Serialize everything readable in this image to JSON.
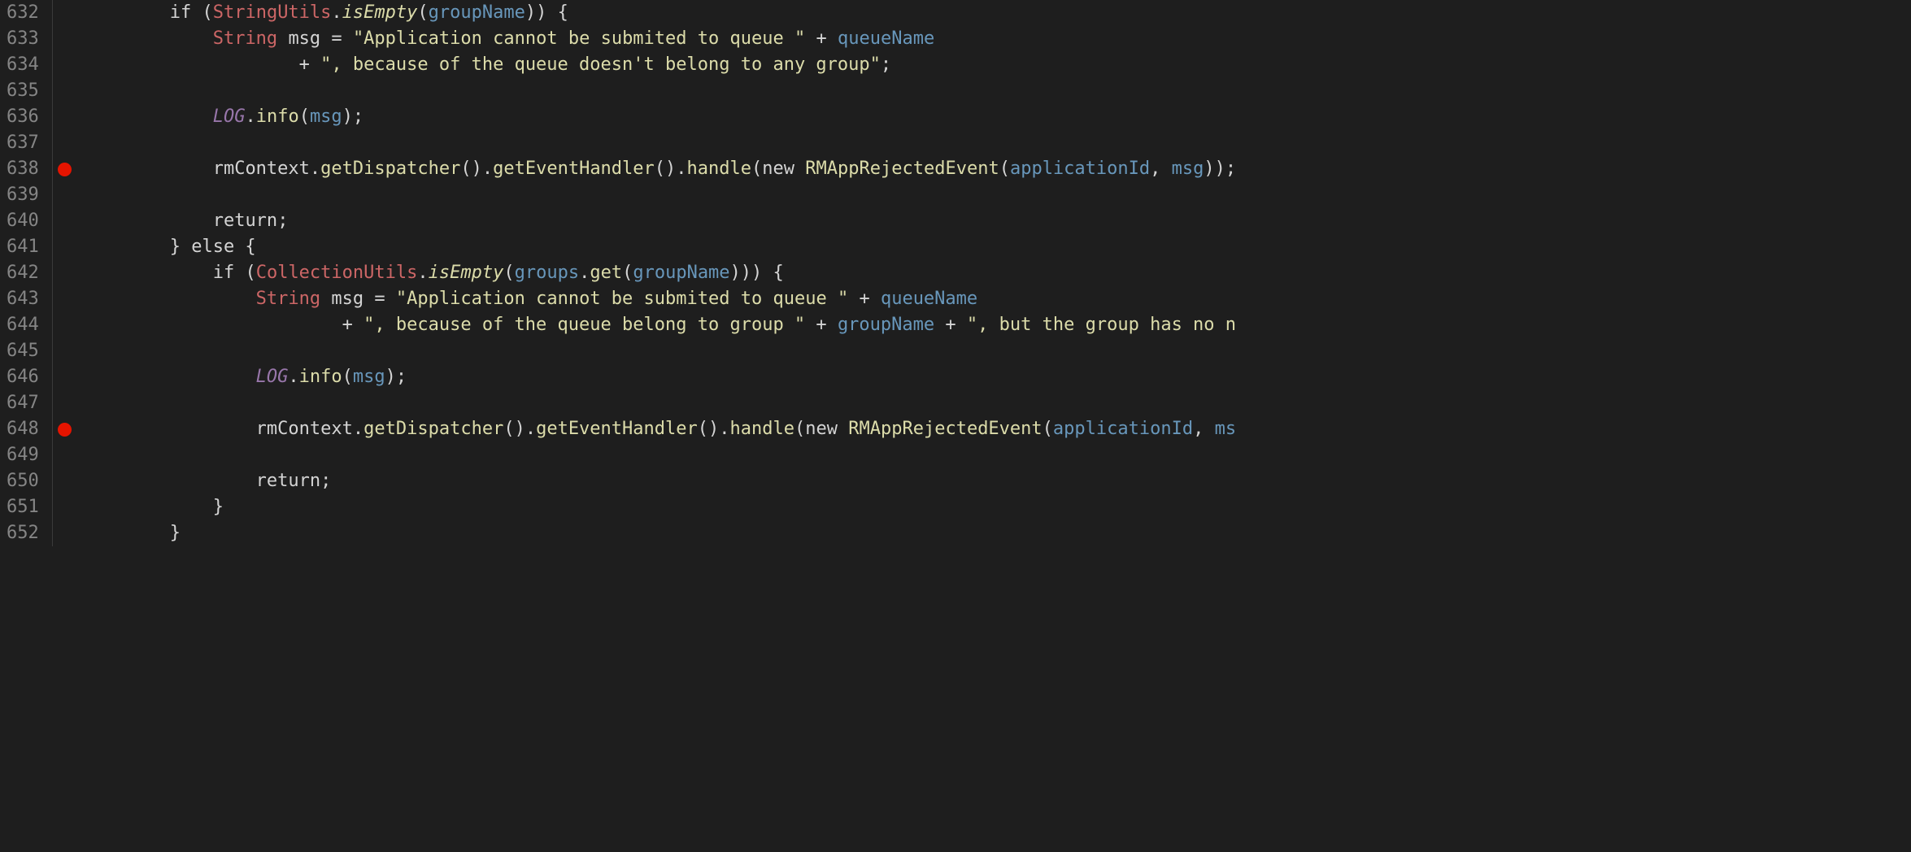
{
  "lines": [
    {
      "num": "632",
      "breakpoint": false,
      "tokens": [
        {
          "t": "        ",
          "c": ""
        },
        {
          "t": "if",
          "c": "keyword-control"
        },
        {
          "t": " (",
          "c": "paren"
        },
        {
          "t": "StringUtils",
          "c": "type"
        },
        {
          "t": ".",
          "c": "operator"
        },
        {
          "t": "isEmpty",
          "c": "method-static"
        },
        {
          "t": "(",
          "c": "paren"
        },
        {
          "t": "groupName",
          "c": "variable-blue"
        },
        {
          "t": ")) {",
          "c": "paren"
        }
      ]
    },
    {
      "num": "633",
      "breakpoint": false,
      "tokens": [
        {
          "t": "            ",
          "c": ""
        },
        {
          "t": "String",
          "c": "type"
        },
        {
          "t": " ",
          "c": ""
        },
        {
          "t": "msg",
          "c": "class-name"
        },
        {
          "t": " = ",
          "c": "operator"
        },
        {
          "t": "\"Application cannot be submited to queue \"",
          "c": "string"
        },
        {
          "t": " + ",
          "c": "operator"
        },
        {
          "t": "queueName",
          "c": "variable-blue"
        }
      ]
    },
    {
      "num": "634",
      "breakpoint": false,
      "tokens": [
        {
          "t": "                    + ",
          "c": "operator"
        },
        {
          "t": "\", because of the queue doesn't belong to any group\"",
          "c": "string"
        },
        {
          "t": ";",
          "c": "semicolon"
        }
      ]
    },
    {
      "num": "635",
      "breakpoint": false,
      "tokens": []
    },
    {
      "num": "636",
      "breakpoint": false,
      "tokens": [
        {
          "t": "            ",
          "c": ""
        },
        {
          "t": "LOG",
          "c": "static-field"
        },
        {
          "t": ".",
          "c": "operator"
        },
        {
          "t": "info",
          "c": "method"
        },
        {
          "t": "(",
          "c": "paren"
        },
        {
          "t": "msg",
          "c": "variable-blue"
        },
        {
          "t": ");",
          "c": "paren"
        }
      ]
    },
    {
      "num": "637",
      "breakpoint": false,
      "tokens": []
    },
    {
      "num": "638",
      "breakpoint": true,
      "tokens": [
        {
          "t": "            ",
          "c": ""
        },
        {
          "t": "rmContext",
          "c": "class-name"
        },
        {
          "t": ".",
          "c": "operator"
        },
        {
          "t": "getDispatcher",
          "c": "method"
        },
        {
          "t": "().",
          "c": "paren"
        },
        {
          "t": "getEventHandler",
          "c": "method"
        },
        {
          "t": "().",
          "c": "paren"
        },
        {
          "t": "handle",
          "c": "method"
        },
        {
          "t": "(",
          "c": "paren"
        },
        {
          "t": "new",
          "c": "keyword-control"
        },
        {
          "t": " ",
          "c": ""
        },
        {
          "t": "RMAppRejectedEvent",
          "c": "method"
        },
        {
          "t": "(",
          "c": "paren"
        },
        {
          "t": "applicationId",
          "c": "variable-blue"
        },
        {
          "t": ", ",
          "c": "operator"
        },
        {
          "t": "msg",
          "c": "variable-blue"
        },
        {
          "t": "));",
          "c": "paren"
        }
      ]
    },
    {
      "num": "639",
      "breakpoint": false,
      "tokens": []
    },
    {
      "num": "640",
      "breakpoint": false,
      "tokens": [
        {
          "t": "            ",
          "c": ""
        },
        {
          "t": "return",
          "c": "keyword-control"
        },
        {
          "t": ";",
          "c": "semicolon"
        }
      ]
    },
    {
      "num": "641",
      "breakpoint": false,
      "tokens": [
        {
          "t": "        } ",
          "c": "paren"
        },
        {
          "t": "else",
          "c": "keyword-control"
        },
        {
          "t": " {",
          "c": "paren"
        }
      ]
    },
    {
      "num": "642",
      "breakpoint": false,
      "tokens": [
        {
          "t": "            ",
          "c": ""
        },
        {
          "t": "if",
          "c": "keyword-control"
        },
        {
          "t": " (",
          "c": "paren"
        },
        {
          "t": "CollectionUtils",
          "c": "type"
        },
        {
          "t": ".",
          "c": "operator"
        },
        {
          "t": "isEmpty",
          "c": "method-static"
        },
        {
          "t": "(",
          "c": "paren"
        },
        {
          "t": "groups",
          "c": "variable-blue"
        },
        {
          "t": ".",
          "c": "operator"
        },
        {
          "t": "get",
          "c": "method"
        },
        {
          "t": "(",
          "c": "paren"
        },
        {
          "t": "groupName",
          "c": "variable-blue"
        },
        {
          "t": "))) {",
          "c": "paren"
        }
      ]
    },
    {
      "num": "643",
      "breakpoint": false,
      "tokens": [
        {
          "t": "                ",
          "c": ""
        },
        {
          "t": "String",
          "c": "type"
        },
        {
          "t": " ",
          "c": ""
        },
        {
          "t": "msg",
          "c": "class-name"
        },
        {
          "t": " = ",
          "c": "operator"
        },
        {
          "t": "\"Application cannot be submited to queue \"",
          "c": "string"
        },
        {
          "t": " + ",
          "c": "operator"
        },
        {
          "t": "queueName",
          "c": "variable-blue"
        }
      ]
    },
    {
      "num": "644",
      "breakpoint": false,
      "tokens": [
        {
          "t": "                        + ",
          "c": "operator"
        },
        {
          "t": "\", because of the queue belong to group \"",
          "c": "string"
        },
        {
          "t": " + ",
          "c": "operator"
        },
        {
          "t": "groupName",
          "c": "variable-blue"
        },
        {
          "t": " + ",
          "c": "operator"
        },
        {
          "t": "\", but the group has no n",
          "c": "string"
        }
      ]
    },
    {
      "num": "645",
      "breakpoint": false,
      "tokens": []
    },
    {
      "num": "646",
      "breakpoint": false,
      "tokens": [
        {
          "t": "                ",
          "c": ""
        },
        {
          "t": "LOG",
          "c": "static-field"
        },
        {
          "t": ".",
          "c": "operator"
        },
        {
          "t": "info",
          "c": "method"
        },
        {
          "t": "(",
          "c": "paren"
        },
        {
          "t": "msg",
          "c": "variable-blue"
        },
        {
          "t": ");",
          "c": "paren"
        }
      ]
    },
    {
      "num": "647",
      "breakpoint": false,
      "tokens": []
    },
    {
      "num": "648",
      "breakpoint": true,
      "tokens": [
        {
          "t": "                ",
          "c": ""
        },
        {
          "t": "rmContext",
          "c": "class-name"
        },
        {
          "t": ".",
          "c": "operator"
        },
        {
          "t": "getDispatcher",
          "c": "method"
        },
        {
          "t": "().",
          "c": "paren"
        },
        {
          "t": "getEventHandler",
          "c": "method"
        },
        {
          "t": "().",
          "c": "paren"
        },
        {
          "t": "handle",
          "c": "method"
        },
        {
          "t": "(",
          "c": "paren"
        },
        {
          "t": "new",
          "c": "keyword-control"
        },
        {
          "t": " ",
          "c": ""
        },
        {
          "t": "RMAppRejectedEvent",
          "c": "method"
        },
        {
          "t": "(",
          "c": "paren"
        },
        {
          "t": "applicationId",
          "c": "variable-blue"
        },
        {
          "t": ", ",
          "c": "operator"
        },
        {
          "t": "ms",
          "c": "variable-blue"
        }
      ]
    },
    {
      "num": "649",
      "breakpoint": false,
      "tokens": []
    },
    {
      "num": "650",
      "breakpoint": false,
      "tokens": [
        {
          "t": "                ",
          "c": ""
        },
        {
          "t": "return",
          "c": "keyword-control"
        },
        {
          "t": ";",
          "c": "semicolon"
        }
      ]
    },
    {
      "num": "651",
      "breakpoint": false,
      "tokens": [
        {
          "t": "            }",
          "c": "paren"
        }
      ]
    },
    {
      "num": "652",
      "breakpoint": false,
      "tokens": [
        {
          "t": "        }",
          "c": "paren"
        }
      ]
    }
  ]
}
